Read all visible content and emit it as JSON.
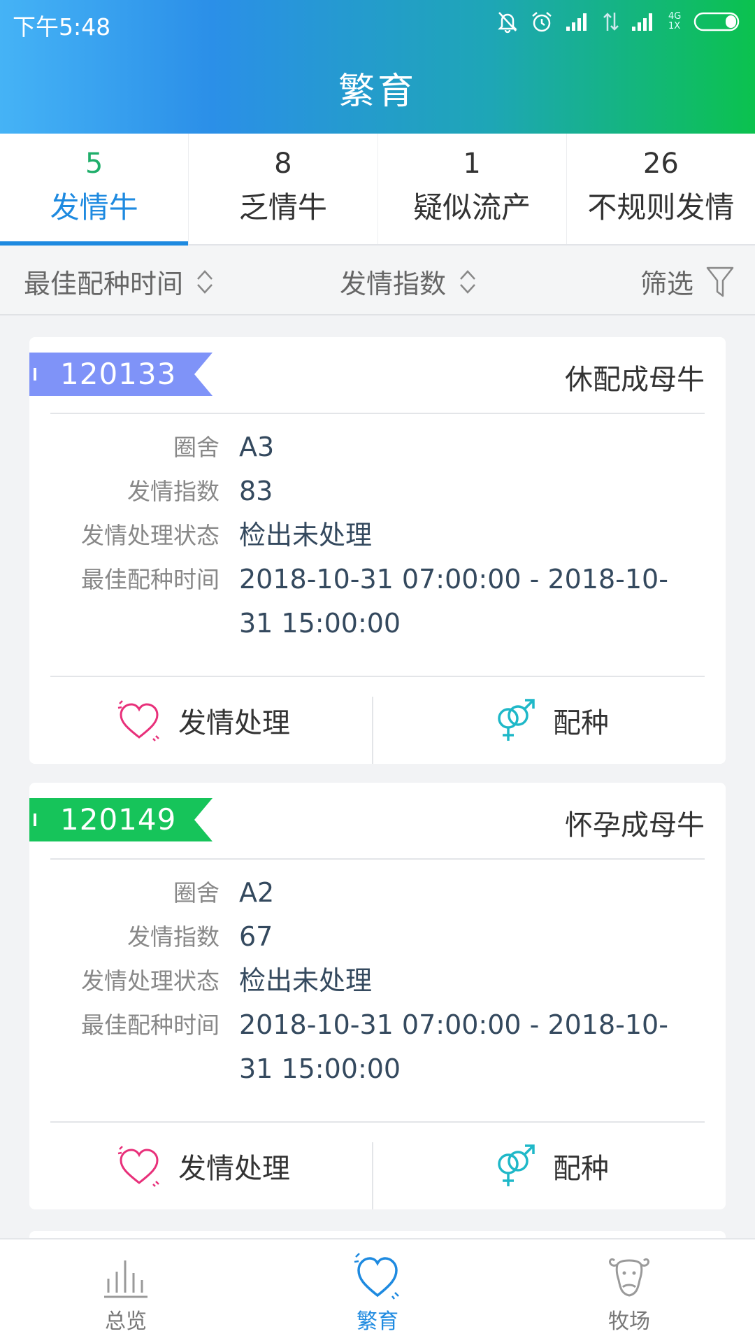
{
  "status_bar": {
    "time": "下午5:48",
    "network": "4G\n1X"
  },
  "header": {
    "title": "繁育"
  },
  "tabs": [
    {
      "count": "5",
      "label": "发情牛",
      "active": true
    },
    {
      "count": "8",
      "label": "乏情牛",
      "active": false
    },
    {
      "count": "1",
      "label": "疑似流产",
      "active": false
    },
    {
      "count": "26",
      "label": "不规则发情",
      "active": false
    }
  ],
  "sortbar": {
    "sort_best_time": "最佳配种时间",
    "sort_estrus_index": "发情指数",
    "filter": "筛选"
  },
  "labels": {
    "pen": "圈舍",
    "estrus_index": "发情指数",
    "status": "发情处理状态",
    "best_time": "最佳配种时间"
  },
  "cards": [
    {
      "id": "120133",
      "tag_color": "#7f93f8",
      "cow_type": "休配成母牛",
      "pen": "A3",
      "estrus_index": "83",
      "status": "检出未处理",
      "best_time": "2018-10-31 07:00:00 - 2018-10-31 15:00:00",
      "action_estrus": "发情处理",
      "action_breed": "配种"
    },
    {
      "id": "120149",
      "tag_color": "#16c45a",
      "cow_type": "怀孕成母牛",
      "pen": "A2",
      "estrus_index": "67",
      "status": "检出未处理",
      "best_time": "2018-10-31 07:00:00 - 2018-10-31 15:00:00",
      "action_estrus": "发情处理",
      "action_breed": "配种"
    }
  ],
  "bottom_nav": [
    {
      "label": "总览",
      "icon": "bar-chart-icon",
      "active": false
    },
    {
      "label": "繁育",
      "icon": "heart-icon",
      "active": true
    },
    {
      "label": "牧场",
      "icon": "cow-icon",
      "active": false
    }
  ],
  "colors": {
    "accent": "#1e8ae0",
    "active_count": "#1fae6a",
    "heart": "#e8307a",
    "gender": "#1fb8c8"
  }
}
